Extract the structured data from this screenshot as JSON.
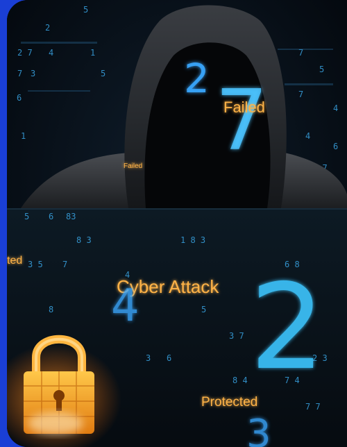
{
  "overlay_text": {
    "failed_main": "Failed",
    "failed_small": "Failed",
    "cyber_attack": "Cyber Attack",
    "protected": "Protected",
    "partial_left": "ted"
  },
  "digits": {
    "big_two_top": "2",
    "big_seven": "7",
    "big_four": "4",
    "big_two_right": "2",
    "big_three_bottom": "3"
  },
  "colors": {
    "frame": "#1a3fd6",
    "digit_blue": "#3fb8ff",
    "text_orange": "#ffb347",
    "lock_gold": "#ffaa22"
  }
}
